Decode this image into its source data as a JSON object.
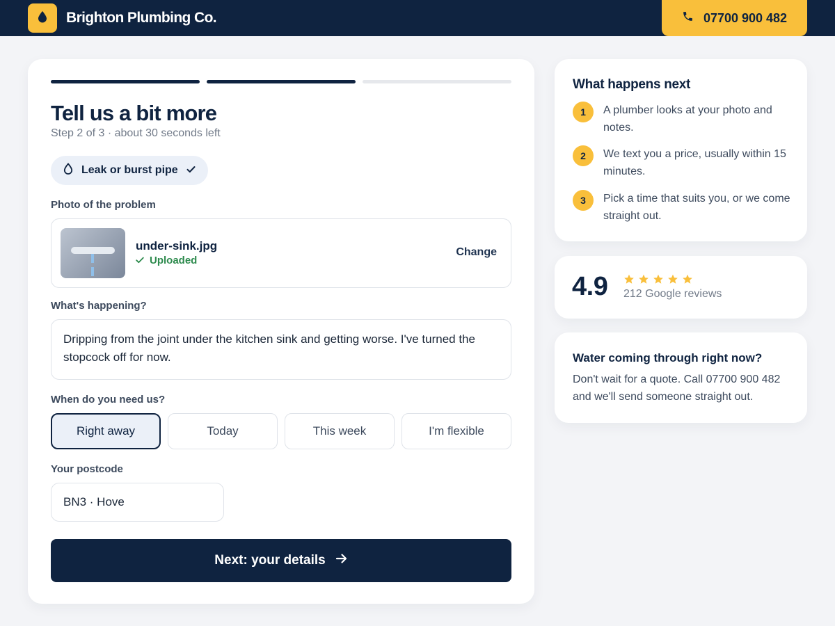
{
  "header": {
    "brand": "Brighton Plumbing Co.",
    "phone": "07700 900 482",
    "logo_icon": "water-drop-icon",
    "phone_icon": "phone-icon",
    "accent_color": "#f9bf3b",
    "navy_color": "#0f2340"
  },
  "form": {
    "progress": {
      "current_step": 2,
      "total_steps": 3
    },
    "title": "Tell us a bit more",
    "subtitle": "Step 2 of 3 · about 30 seconds left",
    "problem_chip": {
      "label": "Leak or burst pipe",
      "icon": "water-drop-icon",
      "check_icon": "check-icon"
    },
    "photo": {
      "label": "Photo of the problem",
      "filename": "under-sink.jpg",
      "status": "Uploaded",
      "status_color": "#2e8b4e",
      "change_label": "Change"
    },
    "description": {
      "label": "What's happening?",
      "value": "Dripping from the joint under the kitchen sink and getting worse. I've turned the stopcock off for now."
    },
    "timing": {
      "label": "When do you need us?",
      "options": [
        "Right away",
        "Today",
        "This week",
        "I'm flexible"
      ],
      "selected": "Right away"
    },
    "postcode": {
      "label": "Your postcode",
      "value": "BN3 · Hove"
    },
    "next_button": "Next: your details"
  },
  "sidebar": {
    "next_steps": {
      "title": "What happens next",
      "steps": [
        {
          "num": "1",
          "text": "A plumber looks at your photo and notes."
        },
        {
          "num": "2",
          "text": "We text you a price, usually within 15 minutes."
        },
        {
          "num": "3",
          "text": "Pick a time that suits you, or we come straight out."
        }
      ]
    },
    "rating": {
      "score": "4.9",
      "stars": 5,
      "reviews": "212 Google reviews"
    },
    "urgent": {
      "title": "Water coming through right now?",
      "text": "Don't wait for a quote. Call 07700 900 482 and we'll send someone straight out."
    }
  }
}
